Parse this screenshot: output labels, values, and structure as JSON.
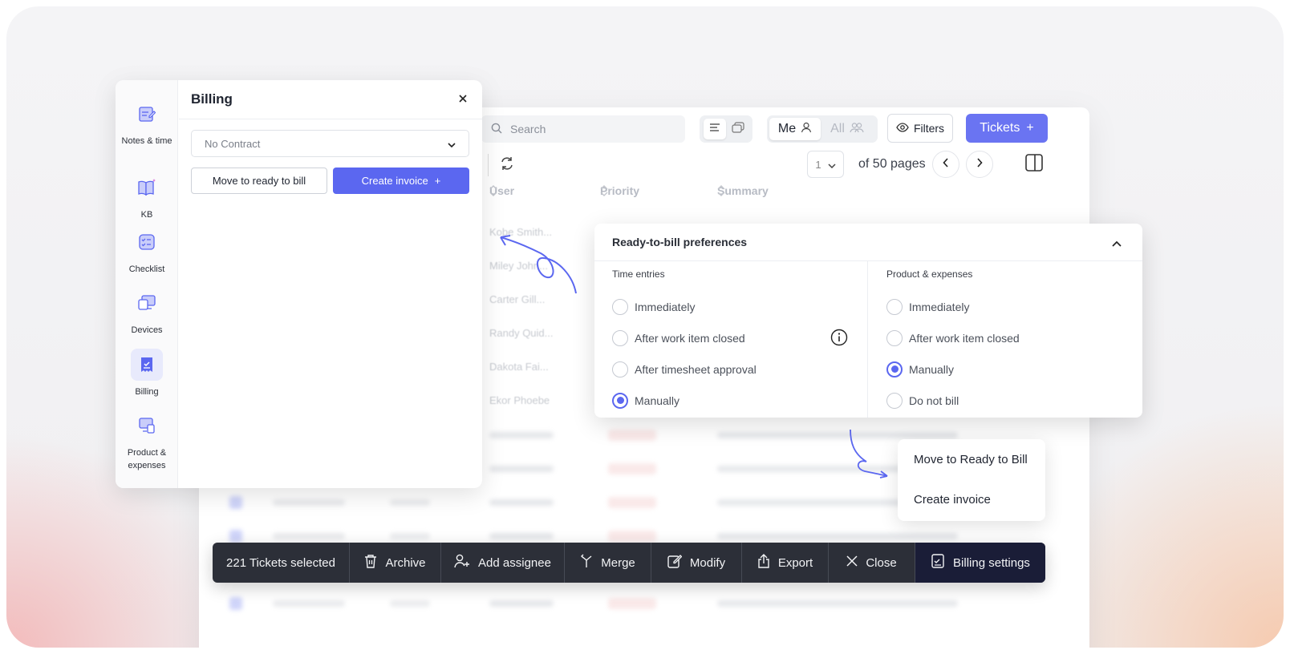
{
  "toolbar": {
    "search_placeholder": "Search",
    "me_label": "Me",
    "all_label": "All",
    "filters_label": "Filters",
    "tickets_label": "Tickets",
    "tickets_plus": "+"
  },
  "pager": {
    "page_value": "1",
    "of_pages": "of 50 pages"
  },
  "columns": {
    "user": "User",
    "priority": "Priority",
    "summary": "Summary"
  },
  "ghost_users": [
    "Kobe Smith...",
    "Miley John...",
    "Carter Gill...",
    "Randy Quid...",
    "Dakota Fai...",
    "Ekor Phoebe"
  ],
  "billing": {
    "title": "Billing",
    "contract_value": "No Contract",
    "move_ready_label": "Move to ready to bill",
    "create_invoice_label": "Create invoice",
    "create_invoice_plus": "+",
    "rail": [
      {
        "label": "Notes & time",
        "icon": "notes-time-icon"
      },
      {
        "label": "KB",
        "icon": "kb-book-icon"
      },
      {
        "label": "Checklist",
        "icon": "checklist-icon"
      },
      {
        "label": "Devices",
        "icon": "devices-icon"
      },
      {
        "label": "Billing",
        "icon": "billing-icon",
        "active": true
      },
      {
        "label": "Product & expenses",
        "icon": "product-expenses-icon"
      }
    ]
  },
  "prefs": {
    "title": "Ready-to-bill preferences",
    "time_entries": {
      "title": "Time entries",
      "options": [
        "Immediately",
        "After work item closed",
        "After timesheet approval",
        "Manually"
      ],
      "selected": "Manually"
    },
    "product_expenses": {
      "title": "Product & expenses",
      "options": [
        "Immediately",
        "After work item closed",
        "Manually",
        "Do not bill"
      ],
      "selected": "Manually"
    }
  },
  "context_menu": {
    "items": [
      "Move to Ready to Bill",
      "Create invoice"
    ]
  },
  "actionbar": {
    "selected_count": "221 Tickets selected",
    "archive": "Archive",
    "add_assignee": "Add assignee",
    "merge": "Merge",
    "modify": "Modify",
    "export": "Export",
    "close": "Close",
    "billing_settings": "Billing settings"
  },
  "colors": {
    "accent": "#5b67f0",
    "tickets_button": "#6a74f2",
    "actionbar": "#2c2f38",
    "actionbar_highlight": "#1a1d37"
  }
}
